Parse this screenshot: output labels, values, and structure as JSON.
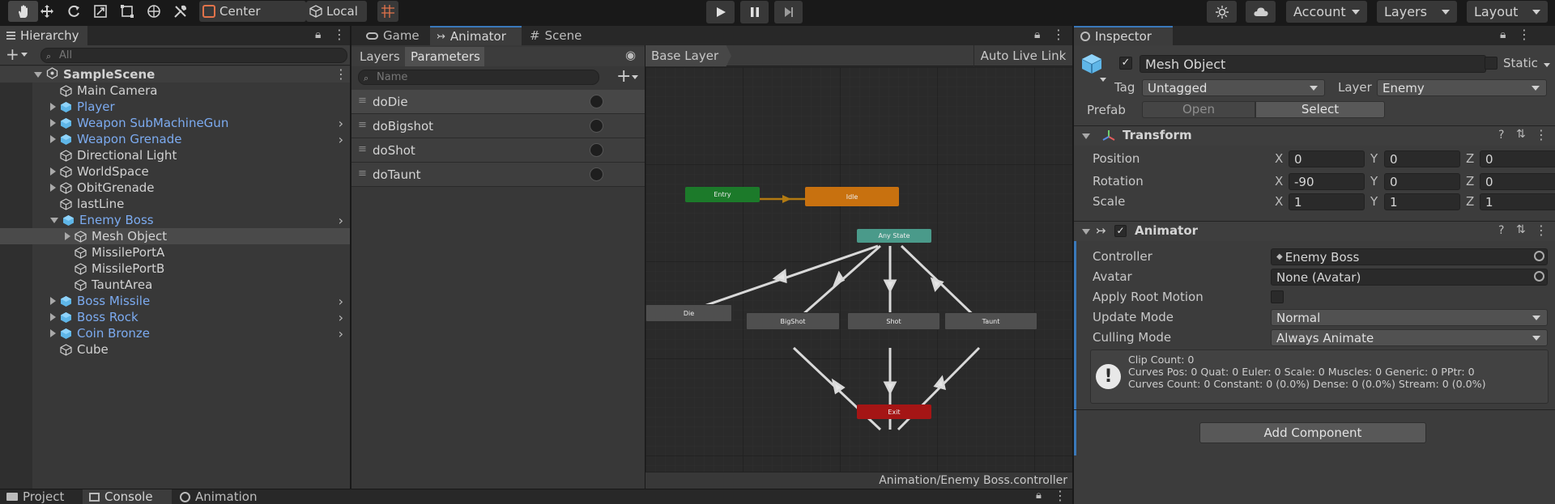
{
  "toolbar": {
    "tools": [
      "hand-tool",
      "move-tool",
      "rotate-tool",
      "scale-tool",
      "rect-tool",
      "transform-tool",
      "custom-tool"
    ],
    "pivot_label": "Center",
    "space_label": "Local",
    "account_label": "Account",
    "layers_label": "Layers",
    "layout_label": "Layout"
  },
  "hierarchy": {
    "tab_label": "Hierarchy",
    "search_placeholder": "All",
    "scene_name": "SampleScene",
    "items": [
      {
        "label": "Main Camera",
        "indent": 1,
        "expander": false,
        "blue": false,
        "chevron": false
      },
      {
        "label": "Player",
        "indent": 1,
        "expander": true,
        "blue": true,
        "chevron": false
      },
      {
        "label": "Weapon SubMachineGun",
        "indent": 1,
        "expander": true,
        "blue": true,
        "chevron": true
      },
      {
        "label": "Weapon Grenade",
        "indent": 1,
        "expander": true,
        "blue": true,
        "chevron": true
      },
      {
        "label": "Directional Light",
        "indent": 1,
        "expander": false,
        "blue": false,
        "chevron": false
      },
      {
        "label": "WorldSpace",
        "indent": 1,
        "expander": true,
        "blue": false,
        "chevron": false
      },
      {
        "label": "ObitGrenade",
        "indent": 1,
        "expander": true,
        "blue": false,
        "chevron": false
      },
      {
        "label": "lastLine",
        "indent": 1,
        "expander": false,
        "blue": false,
        "chevron": false
      },
      {
        "label": "Enemy Boss",
        "indent": 1,
        "expander": true,
        "blue": true,
        "chevron": true,
        "expanded": true
      },
      {
        "label": "Mesh Object",
        "indent": 2,
        "expander": true,
        "blue": false,
        "chevron": false,
        "selected": true
      },
      {
        "label": "MissilePortA",
        "indent": 2,
        "expander": false,
        "blue": false,
        "chevron": false
      },
      {
        "label": "MissilePortB",
        "indent": 2,
        "expander": false,
        "blue": false,
        "chevron": false
      },
      {
        "label": "TauntArea",
        "indent": 2,
        "expander": false,
        "blue": false,
        "chevron": false
      },
      {
        "label": "Boss Missile",
        "indent": 1,
        "expander": true,
        "blue": true,
        "chevron": true
      },
      {
        "label": "Boss Rock",
        "indent": 1,
        "expander": true,
        "blue": true,
        "chevron": true
      },
      {
        "label": "Coin Bronze",
        "indent": 1,
        "expander": true,
        "blue": true,
        "chevron": true
      },
      {
        "label": "Cube",
        "indent": 1,
        "expander": false,
        "blue": false,
        "chevron": false
      }
    ]
  },
  "center_tabs": {
    "game": "Game",
    "animator": "Animator",
    "scene": "Scene"
  },
  "animator": {
    "layers_tab": "Layers",
    "parameters_tab": "Parameters",
    "search_placeholder": "Name",
    "parameters": [
      "doDie",
      "doBigshot",
      "doShot",
      "doTaunt"
    ],
    "breadcrumb": "Base Layer",
    "auto_live_link": "Auto Live Link",
    "footer_path": "Animation/Enemy Boss.controller",
    "states": {
      "entry": "Entry",
      "idle": "Idle",
      "any": "Any State",
      "die": "Die",
      "bigshot": "BigShot",
      "shot": "Shot",
      "taunt": "Taunt",
      "exit": "Exit"
    },
    "colors": {
      "entry": "#1c7a2a",
      "idle": "#c8710f",
      "any": "#4a9a8a",
      "exit": "#a51515",
      "state": "#4f4f4f"
    }
  },
  "bottom_tabs": {
    "project": "Project",
    "console": "Console",
    "animation": "Animation"
  },
  "inspector": {
    "tab_label": "Inspector",
    "object_name": "Mesh Object",
    "static_label": "Static",
    "tag_label": "Tag",
    "tag_value": "Untagged",
    "layer_label": "Layer",
    "layer_value": "Enemy",
    "prefab_label": "Prefab",
    "prefab_open": "Open",
    "prefab_select": "Select",
    "transform": {
      "title": "Transform",
      "rows": [
        {
          "label": "Position",
          "x": "0",
          "y": "0",
          "z": "0"
        },
        {
          "label": "Rotation",
          "x": "-90",
          "y": "0",
          "z": "0"
        },
        {
          "label": "Scale",
          "x": "1",
          "y": "1",
          "z": "1"
        }
      ]
    },
    "animator_comp": {
      "title": "Animator",
      "controller_label": "Controller",
      "controller_value": "Enemy Boss",
      "avatar_label": "Avatar",
      "avatar_value": "None (Avatar)",
      "root_motion_label": "Apply Root Motion",
      "update_mode_label": "Update Mode",
      "update_mode_value": "Normal",
      "culling_mode_label": "Culling Mode",
      "culling_mode_value": "Always Animate",
      "info_lines": [
        "Clip Count: 0",
        "Curves Pos: 0 Quat: 0 Euler: 0 Scale: 0 Muscles: 0 Generic: 0 PPtr: 0",
        "Curves Count: 0 Constant: 0 (0.0%) Dense: 0 (0.0%) Stream: 0 (0.0%)"
      ]
    },
    "add_component": "Add Component"
  }
}
